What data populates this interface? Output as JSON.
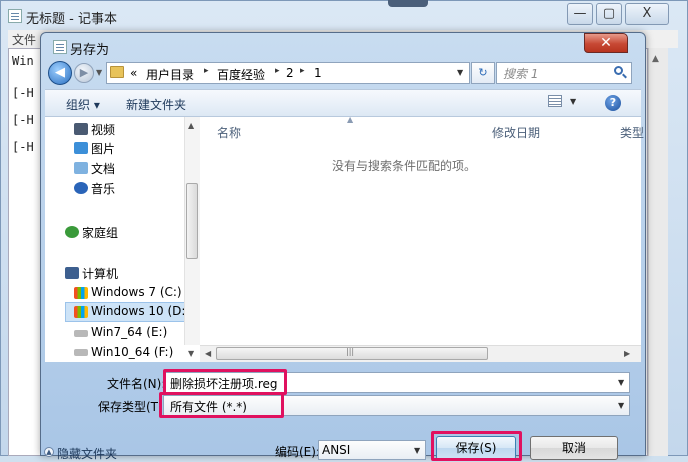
{
  "notepad": {
    "title": "无标题 - 记事本",
    "menu_file": "文件",
    "lines": [
      "Win",
      "[-H",
      "[-H",
      "[-H"
    ],
    "min_glyph": "—",
    "max_glyph": "▢",
    "close_glyph": "X"
  },
  "dialog": {
    "title": "另存为",
    "close_glyph": "✕",
    "breadcrumb": {
      "overflow": "«",
      "items": [
        "用户目录",
        "百度经验",
        "2",
        "1"
      ],
      "separator": "▸"
    },
    "search_placeholder": "搜索 1",
    "toolbar": {
      "organize": "组织 ▾",
      "new_folder": "新建文件夹",
      "help_glyph": "?"
    },
    "nav": {
      "items": [
        {
          "label": "视频",
          "icon": "video-icon"
        },
        {
          "label": "图片",
          "icon": "picture-icon"
        },
        {
          "label": "文档",
          "icon": "document-icon"
        },
        {
          "label": "音乐",
          "icon": "music-icon"
        },
        {
          "label": "家庭组",
          "icon": "homegroup-icon"
        },
        {
          "label": "计算机",
          "icon": "computer-icon"
        },
        {
          "label": "Windows 7 (C:)",
          "icon": "drive-icon"
        },
        {
          "label": "Windows 10 (D:)",
          "icon": "drive-icon",
          "selected": true
        },
        {
          "label": "Win7_64 (E:)",
          "icon": "drive-icon"
        },
        {
          "label": "Win10_64 (F:)",
          "icon": "drive-icon"
        }
      ]
    },
    "columns": {
      "name": "名称",
      "date": "修改日期",
      "type": "类型"
    },
    "empty_message": "没有与搜索条件匹配的项。",
    "filename_label": "文件名(N):",
    "filename_value": "删除损坏注册项.reg",
    "filetype_label": "保存类型(T):",
    "filetype_value": "所有文件  (*.*)",
    "hide_folders": "隐藏文件夹",
    "encoding_label": "编码(E):",
    "encoding_value": "ANSI",
    "save_button": "保存(S)",
    "cancel_button": "取消",
    "scroll_grip": "|||"
  },
  "colors": {
    "highlight": "#e0115f",
    "titlebar": "#c8dcf0",
    "close_red": "#c74834"
  }
}
